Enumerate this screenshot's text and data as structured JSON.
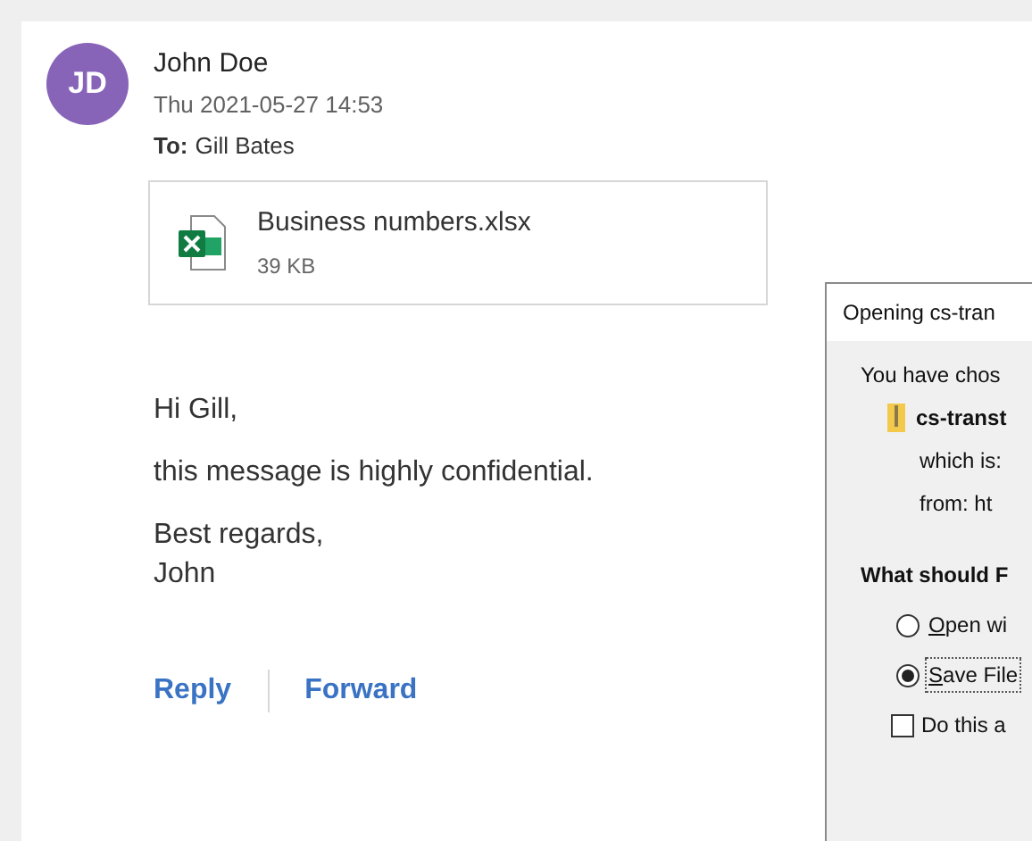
{
  "email": {
    "avatar_initials": "JD",
    "sender": "John Doe",
    "date": "Thu 2021-05-27 14:53",
    "to_label": "To:",
    "to": "Gill Bates",
    "attachment": {
      "name": "Business numbers.xlsx",
      "size": "39 KB"
    },
    "body": [
      "Hi Gill,",
      "this message is highly confidential.",
      "Best regards,\nJohn"
    ],
    "actions": [
      "Reply",
      "Forward"
    ]
  },
  "dialog": {
    "title": "Opening cs-tran",
    "intro": "You have chos",
    "file_name": "cs-transt",
    "which_is": "which is:",
    "from": "from: ht",
    "question": "What should F",
    "options": [
      {
        "kind": "radio",
        "label": "Open wi",
        "selected": false
      },
      {
        "kind": "radio",
        "label": "Save File",
        "selected": true
      },
      {
        "kind": "checkbox",
        "label": "Do this a",
        "checked": false
      }
    ]
  }
}
